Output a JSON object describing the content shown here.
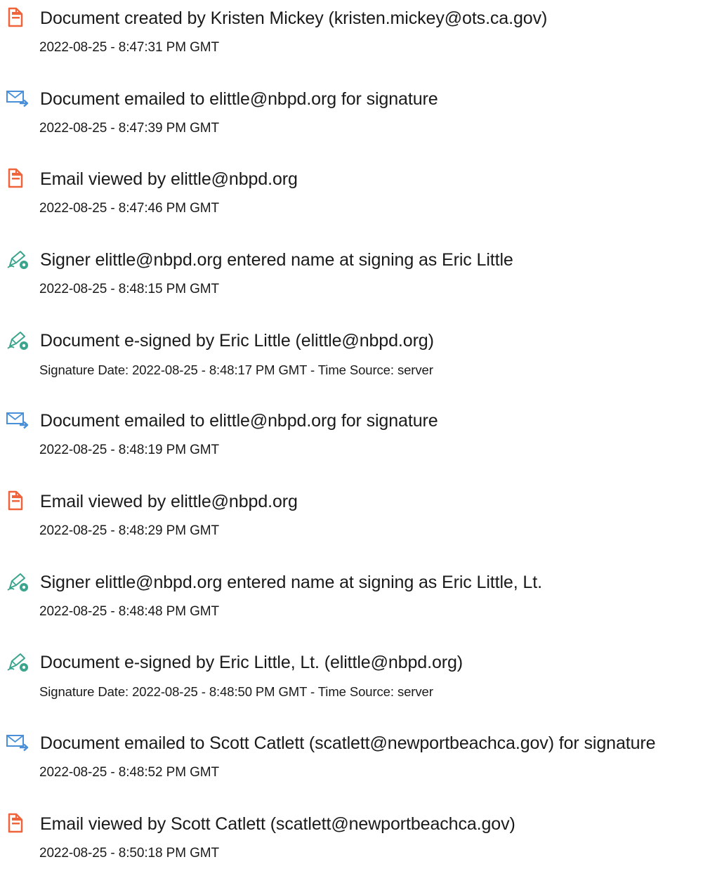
{
  "events": [
    {
      "icon": "document-created-icon",
      "title": "Document created by Kristen Mickey (kristen.mickey@ots.ca.gov)",
      "meta": "2022-08-25 - 8:47:31 PM GMT"
    },
    {
      "icon": "email-sent-icon",
      "title": "Document emailed to elittle@nbpd.org for signature",
      "meta": "2022-08-25 - 8:47:39 PM GMT"
    },
    {
      "icon": "document-viewed-icon",
      "title": "Email viewed by elittle@nbpd.org",
      "meta": "2022-08-25 - 8:47:46 PM GMT"
    },
    {
      "icon": "pen-signature-icon",
      "title": "Signer elittle@nbpd.org entered name at signing as Eric Little",
      "meta": "2022-08-25 - 8:48:15 PM GMT"
    },
    {
      "icon": "pen-signature-icon",
      "title": "Document e-signed by Eric Little (elittle@nbpd.org)",
      "meta": "Signature Date: 2022-08-25 - 8:48:17 PM GMT - Time Source: server"
    },
    {
      "icon": "email-sent-icon",
      "title": "Document emailed to elittle@nbpd.org for signature",
      "meta": "2022-08-25 - 8:48:19 PM GMT"
    },
    {
      "icon": "document-viewed-icon",
      "title": "Email viewed by elittle@nbpd.org",
      "meta": "2022-08-25 - 8:48:29 PM GMT"
    },
    {
      "icon": "pen-signature-icon",
      "title": "Signer elittle@nbpd.org entered name at signing as Eric Little, Lt.",
      "meta": "2022-08-25 - 8:48:48 PM GMT"
    },
    {
      "icon": "pen-signature-icon",
      "title": "Document e-signed by Eric Little, Lt. (elittle@nbpd.org)",
      "meta": "Signature Date: 2022-08-25 - 8:48:50 PM GMT - Time Source: server"
    },
    {
      "icon": "email-sent-icon",
      "title": "Document emailed to Scott Catlett (scatlett@newportbeachca.gov) for signature",
      "meta": "2022-08-25 - 8:48:52 PM GMT"
    },
    {
      "icon": "document-viewed-icon",
      "title": "Email viewed by Scott Catlett (scatlett@newportbeachca.gov)",
      "meta": "2022-08-25 - 8:50:18 PM GMT"
    }
  ],
  "colors": {
    "document_icon": "#f0643c",
    "email_icon": "#4a90d9",
    "pen_icon": "#3aa58c"
  }
}
